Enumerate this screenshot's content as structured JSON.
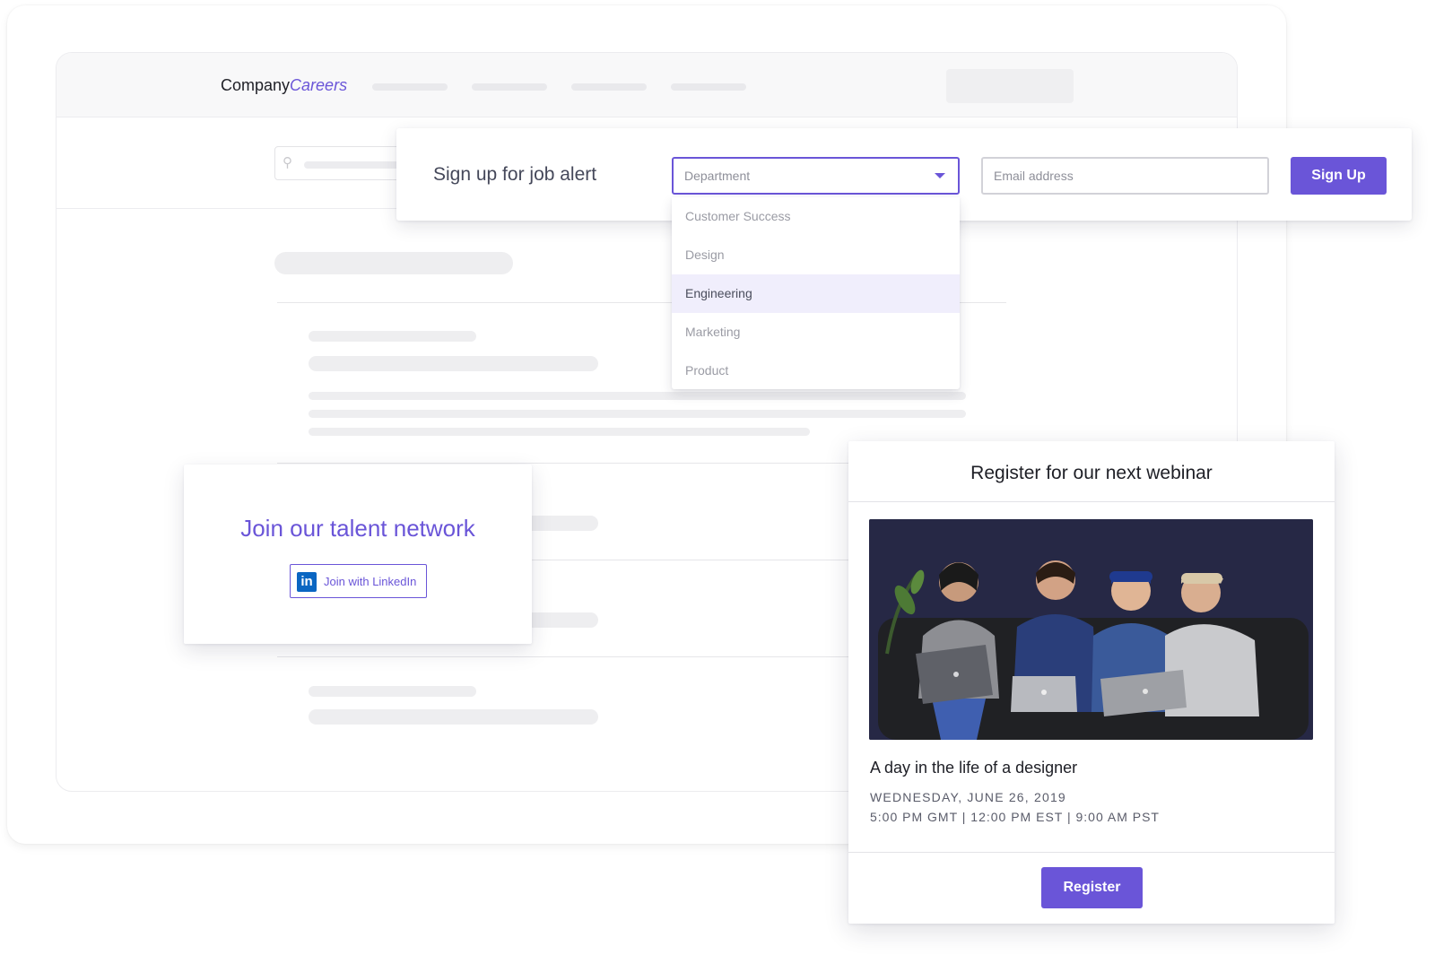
{
  "brand": {
    "company": "Company",
    "careers": "Careers"
  },
  "search": {
    "icon": "search-icon"
  },
  "job_alert": {
    "title": "Sign up for job alert",
    "department_placeholder": "Department",
    "email_placeholder": "Email address",
    "signup_label": "Sign Up",
    "dropdown_options": [
      "Customer Success",
      "Design",
      "Engineering",
      "Marketing",
      "Product"
    ],
    "highlighted_option": "Engineering"
  },
  "talent_network": {
    "title": "Join our talent network",
    "linkedin_logo": "in",
    "linkedin_label": "Join with LinkedIn"
  },
  "webinar": {
    "title": "Register for our next webinar",
    "event_name": "A day in the life of a designer",
    "date": "WEDNESDAY, JUNE 26, 2019",
    "times": "5:00 PM GMT | 12:00 PM EST | 9:00 AM PST",
    "register_label": "Register"
  },
  "colors": {
    "accent": "#6a55d8",
    "linkedin": "#0a66c2",
    "dropdown_highlight": "#f0eefc"
  }
}
